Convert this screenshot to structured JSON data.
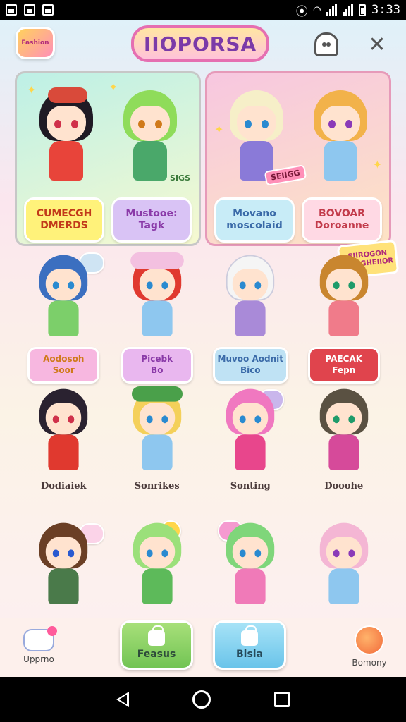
{
  "status_bar": {
    "time": "3:33"
  },
  "header": {
    "logo_text": "Fashion",
    "title": "IIOPORSA"
  },
  "featured": [
    {
      "badges": [
        {
          "line1": "CUMECGH",
          "line2": "DMERDS",
          "bg": "#fff27a",
          "color": "#c23a1a"
        },
        {
          "line1": "Mustooe:",
          "line2": "Tagk",
          "bg": "#d9c3f5",
          "color": "#8a3aa8"
        }
      ],
      "tag": "SIGS"
    },
    {
      "badges": [
        {
          "line1": "Movano",
          "line2": "moscolaid",
          "bg": "#c8ecf7",
          "color": "#3a6aa8"
        },
        {
          "line1": "BOVOAR",
          "line2": "Doroanne",
          "bg": "#ffd9e4",
          "color": "#c23a4a"
        }
      ],
      "tag": "SEIIGG"
    }
  ],
  "grid": [
    {
      "label1": "Aodosoh",
      "label2": "Soor",
      "bg": "#f7b7e0",
      "color": "#d07a1a",
      "hair": "#3b6fc0",
      "body": "#7ccf6a",
      "eye": "#2a8ad0"
    },
    {
      "label1": "Picebk",
      "label2": "Bo",
      "bg": "#e9b7ef",
      "color": "#8a3aa8",
      "hair": "#e0392f",
      "body": "#8ec7ef",
      "eye": "#2a8ad0"
    },
    {
      "label1": "Muvoo Aodnit",
      "label2": "Bico",
      "bg": "#bfe2f4",
      "color": "#3a6aa8",
      "hair": "#f5f5f5",
      "body": "#a98ad8",
      "eye": "#2a8ad0"
    },
    {
      "label1": "PAECAK",
      "label2": "Fepn",
      "bg": "#e0444d",
      "color": "#ffffff",
      "hair": "#c9862f",
      "body": "#f07b8a",
      "eye": "#1f9b6a"
    },
    {
      "name": "Dodiaiek",
      "hair": "#2a2230",
      "body": "#e0392f",
      "eye": "#d0304a"
    },
    {
      "name": "Sonrikes",
      "hair": "#f4d05a",
      "body": "#8ec7ef",
      "eye": "#2a8ad0"
    },
    {
      "name": "Sonting",
      "hair": "#f078c0",
      "body": "#e8468c",
      "eye": "#2a8ad0"
    },
    {
      "name": "Dooohe",
      "hair": "#5a5142",
      "body": "#d64a9a",
      "eye": "#1f9b6a"
    },
    {
      "hair": "#6b3f25",
      "body": "#4a7a4a",
      "eye": "#2a5ad0"
    },
    {
      "hair": "#9be07a",
      "body": "#5dba5a",
      "eye": "#2a8ad0"
    },
    {
      "hair": "#7fd67a",
      "body": "#f07ab8",
      "eye": "#2a8ad0"
    },
    {
      "hair": "#f4b6d4",
      "body": "#8ec7ef",
      "eye": "#8a3ab8"
    }
  ],
  "grid_tag": {
    "line1": "SIIROGON",
    "line2": "HUUGHEIIOR"
  },
  "bottom_nav": {
    "home_label": "Upprno",
    "green_label": "Feasus",
    "blue_label": "Bisia",
    "right_label": "Bomony"
  }
}
